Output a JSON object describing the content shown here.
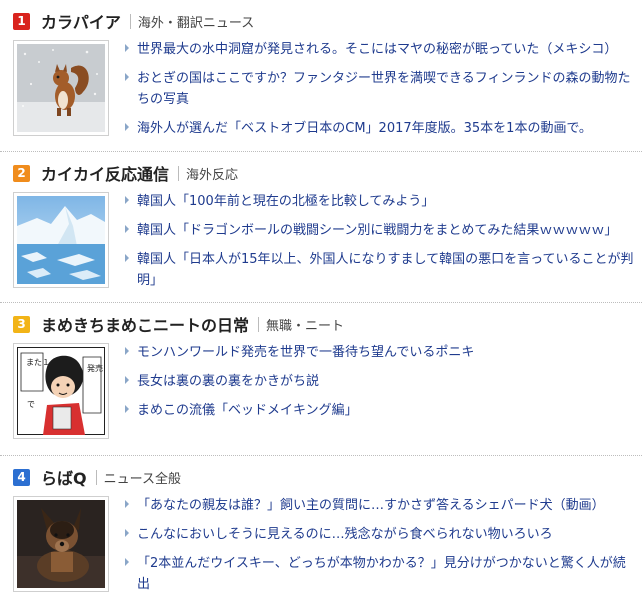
{
  "colors": {
    "rank1": "#d9231d",
    "rank2": "#f08c1c",
    "rank3": "#f2b417",
    "rank4": "#2c6fd1",
    "link": "#1f3b8e",
    "bullet": "#8aa6c8"
  },
  "sections": [
    {
      "rank": "1",
      "site": "カラパイア",
      "category": "海外・翻訳ニュース",
      "thumbnail": "squirrel-in-snow",
      "links": [
        "世界最大の水中洞窟が発見される。そこにはマヤの秘密が眠っていた（メキシコ）",
        "おとぎの国はここですか？ファンタジー世界を満喫できるフィンランドの森の動物たちの写真",
        "海外人が選んだ「ベストオブ日本のCM」2017年度版。35本を1本の動画で。"
      ]
    },
    {
      "rank": "2",
      "site": "カイカイ反応通信",
      "category": "海外反応",
      "thumbnail": "glacier-icebergs",
      "links": [
        "韓国人「100年前と現在の北極を比較してみよう」",
        "韓国人「ドラゴンボールの戦闘シーン別に戦闘力をまとめてみた結果ｗｗｗｗｗ」",
        "韓国人「日本人が15年以上、外国人になりすまして韓国の悪口を言っていることが判明」"
      ]
    },
    {
      "rank": "3",
      "site": "まめきちまめこニートの日常",
      "category": "無職・ニート",
      "thumbnail": "manga-panel",
      "links": [
        "モンハンワールド発売を世界で一番待ち望んでいるポニキ",
        "長女は裏の裏の裏をかきがち説",
        "まめこの流儀「ベッドメイキング編」"
      ]
    },
    {
      "rank": "4",
      "site": "らばQ",
      "category": "ニュース全般",
      "thumbnail": "shepherd-dog",
      "links": [
        "「あなたの親友は誰？」飼い主の質問に…すかさず答えるシェパード犬（動画）",
        "こんなにおいしそうに見えるのに…残念ながら食べられない物いろいろ",
        "「2本並んだウイスキー、どっちが本物かわかる？」見分けがつかないと驚く人が続出"
      ]
    }
  ],
  "manga_text": {
    "bubble1": "発売",
    "bubble2": "また１人",
    "bubble3": "で"
  }
}
